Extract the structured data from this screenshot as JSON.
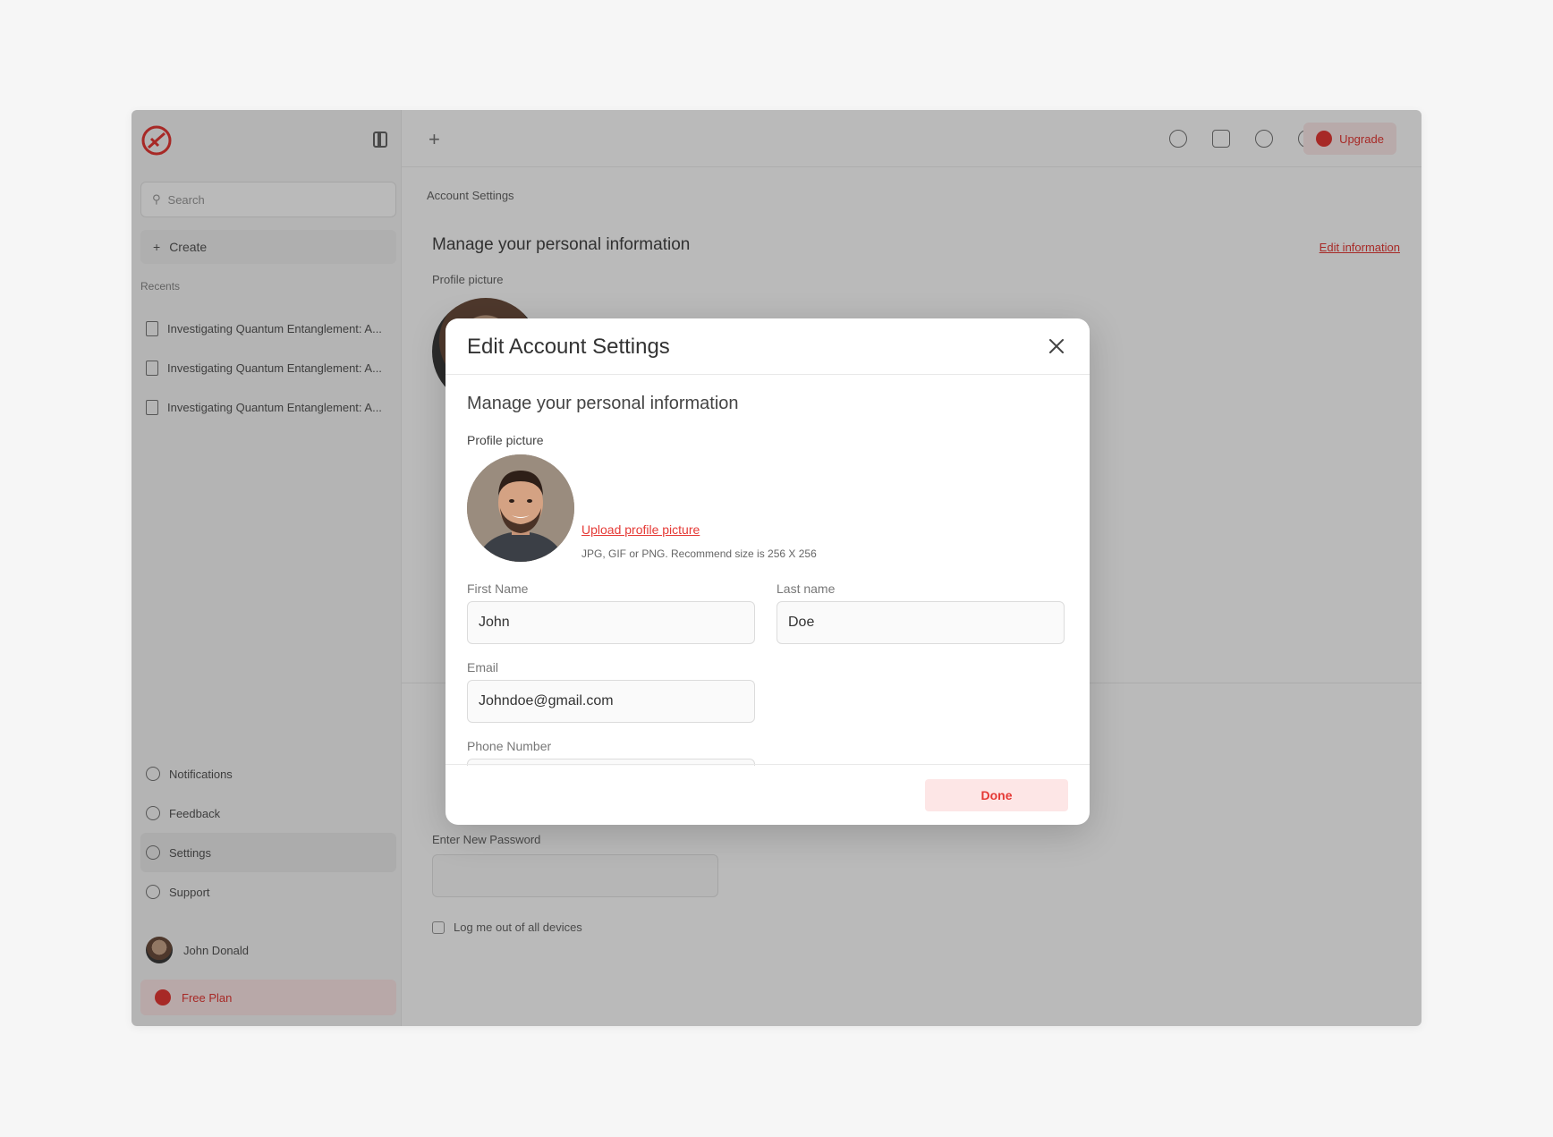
{
  "colors": {
    "accent": "#e53935",
    "accent_soft": "#fde6e6",
    "overlay": "rgba(0,0,0,0.27)"
  },
  "modal": {
    "title": "Edit Account Settings",
    "section_title": "Manage your personal information",
    "profile_picture_label": "Profile picture",
    "upload_link": "Upload profile picture",
    "upload_hint": "JPG, GIF or PNG. Recommend size is 256 X 256",
    "fields": {
      "first_name": {
        "label": "First Name",
        "value": "John"
      },
      "last_name": {
        "label": "Last name",
        "value": "Doe"
      },
      "email": {
        "label": "Email",
        "value": "Johndoe@gmail.com"
      },
      "phone": {
        "label": "Phone Number"
      }
    },
    "done_label": "Done",
    "close_icon": "close-icon"
  },
  "background": {
    "sidebar": {
      "search_placeholder": "Search",
      "create_label": "Create",
      "recents_label": "Recents",
      "recent_items": [
        "Investigating Quantum Entanglement: A...",
        "Investigating Quantum Entanglement: A...",
        "Investigating Quantum Entanglement: A..."
      ],
      "nav": [
        "Notifications",
        "Feedback",
        "Settings",
        "Support"
      ],
      "user_name": "John Donald",
      "plan_label": "Free Plan"
    },
    "topbar": {
      "upgrade_label": "Upgrade"
    },
    "breadcrumb": "Account Settings",
    "title": "Manage your personal information",
    "edit_link": "Edit information",
    "profile_label": "Profile picture",
    "password_label": "Enter New Password",
    "logout_label": "Log me out of all devices"
  }
}
